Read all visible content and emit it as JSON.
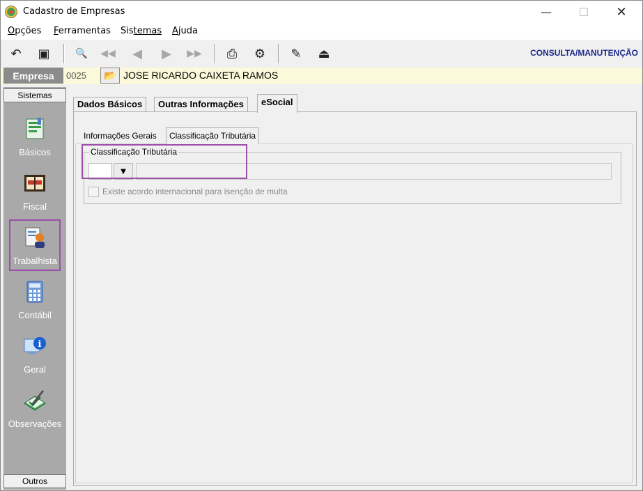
{
  "window": {
    "title": "Cadastro de Empresas",
    "controls": {
      "minimize": "—",
      "maximize": "☐",
      "close": "✕"
    }
  },
  "menu": [
    {
      "label": "Opções",
      "accel": "O",
      "rest": "pções"
    },
    {
      "label": "Ferramentas",
      "accel": "F",
      "rest": "erramentas"
    },
    {
      "label": "Sistemas",
      "accel": "Sis",
      "rest": "temas"
    },
    {
      "label": "Ajuda",
      "accel": "A",
      "rest": "juda"
    }
  ],
  "toolbar": {
    "mode_label": "CONSULTA/MANUTENÇÃO",
    "buttons": {
      "undo": "↶",
      "save": "▣",
      "preview": "🔍",
      "first": "◀◀",
      "prev": "◀",
      "next": "▶",
      "last": "▶▶",
      "print": "⎙",
      "tools": "⚙",
      "edit_doc": "✎",
      "exit": "⏏"
    }
  },
  "empresa": {
    "label": "Empresa",
    "code": "0025",
    "name": "JOSE RICARDO CAIXETA RAMOS",
    "folder_icon": "📂"
  },
  "sidebar": {
    "header": "Sistemas",
    "footer": "Outros",
    "items": [
      {
        "label": "Básicos",
        "icon": "basicos-icon",
        "color": "#3a9a4a"
      },
      {
        "label": "Fiscal",
        "icon": "fiscal-icon",
        "color": "#c0392b"
      },
      {
        "label": "Trabalhista",
        "icon": "trabalhista-icon",
        "color": "#e67e22"
      },
      {
        "label": "Contábil",
        "icon": "contabil-icon",
        "color": "#4a7fc4"
      },
      {
        "label": "Geral",
        "icon": "geral-icon",
        "color": "#1a5fd0"
      },
      {
        "label": "Observações",
        "icon": "observacoes-icon",
        "color": "#3aa55a"
      }
    ]
  },
  "tabs": [
    "Dados Básicos",
    "Outras Informações",
    "eSocial"
  ],
  "active_tab": "eSocial",
  "subtabs": [
    "Informações Gerais",
    "Classificação Tributária"
  ],
  "active_subtab": "Classificação Tributária",
  "group": {
    "legend": "Classificação Tributária",
    "code_value": "",
    "description_value": "",
    "dropdown_icon": "▼",
    "checkbox_label": "Existe acordo internacional para isenção de multa",
    "checkbox_checked": false
  },
  "colors": {
    "highlight": "#9b4fa8",
    "mode_label": "#1c2a8c",
    "empresa_bg": "#fbf9d9",
    "sidebar_bg": "#a9a9a9"
  }
}
